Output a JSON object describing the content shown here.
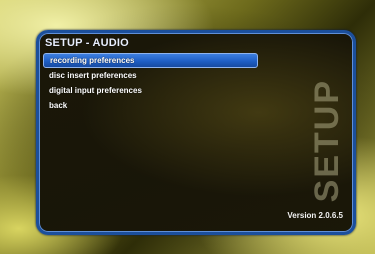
{
  "panel": {
    "title": "SETUP - AUDIO"
  },
  "menu": {
    "items": [
      {
        "label": "recording preferences",
        "selected": true
      },
      {
        "label": "disc insert preferences",
        "selected": false
      },
      {
        "label": "digital input preferences",
        "selected": false
      },
      {
        "label": "back",
        "selected": false
      }
    ]
  },
  "watermark": "SETUP",
  "version": "Version 2.0.6.5",
  "colors": {
    "accent": "#1f5fc5",
    "border": "#1b4f9c",
    "background": "#8a8a38"
  }
}
